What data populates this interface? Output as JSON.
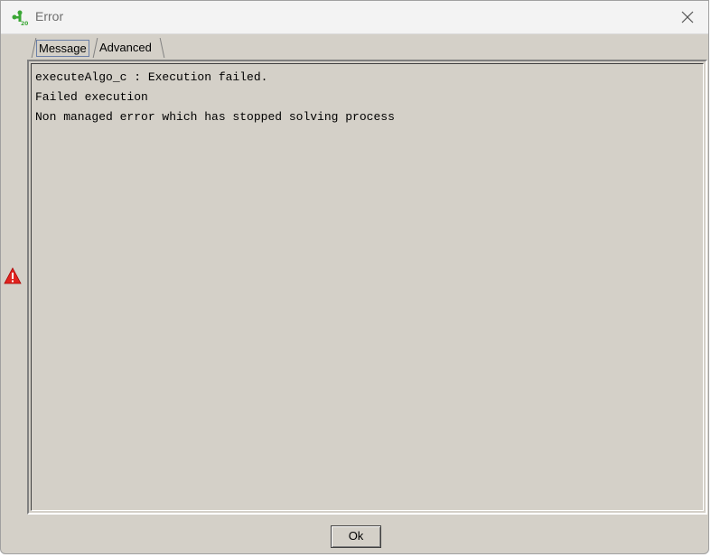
{
  "window": {
    "title": "Error"
  },
  "tabs": [
    {
      "label": "Message",
      "selected": true
    },
    {
      "label": "Advanced",
      "selected": false
    }
  ],
  "message": {
    "lines": [
      "executeAlgo_c : Execution failed.",
      "Failed execution",
      "Non managed error which has stopped solving process"
    ]
  },
  "buttons": {
    "ok_label": "Ok"
  },
  "icons": {
    "app": "app-logo-icon",
    "close": "close-icon",
    "status": "warning-icon"
  },
  "colors": {
    "dialog_bg": "#d4d0c8",
    "titlebar_bg": "#f3f3f3",
    "warning_red": "#e0241f",
    "app_green": "#3aa635"
  }
}
